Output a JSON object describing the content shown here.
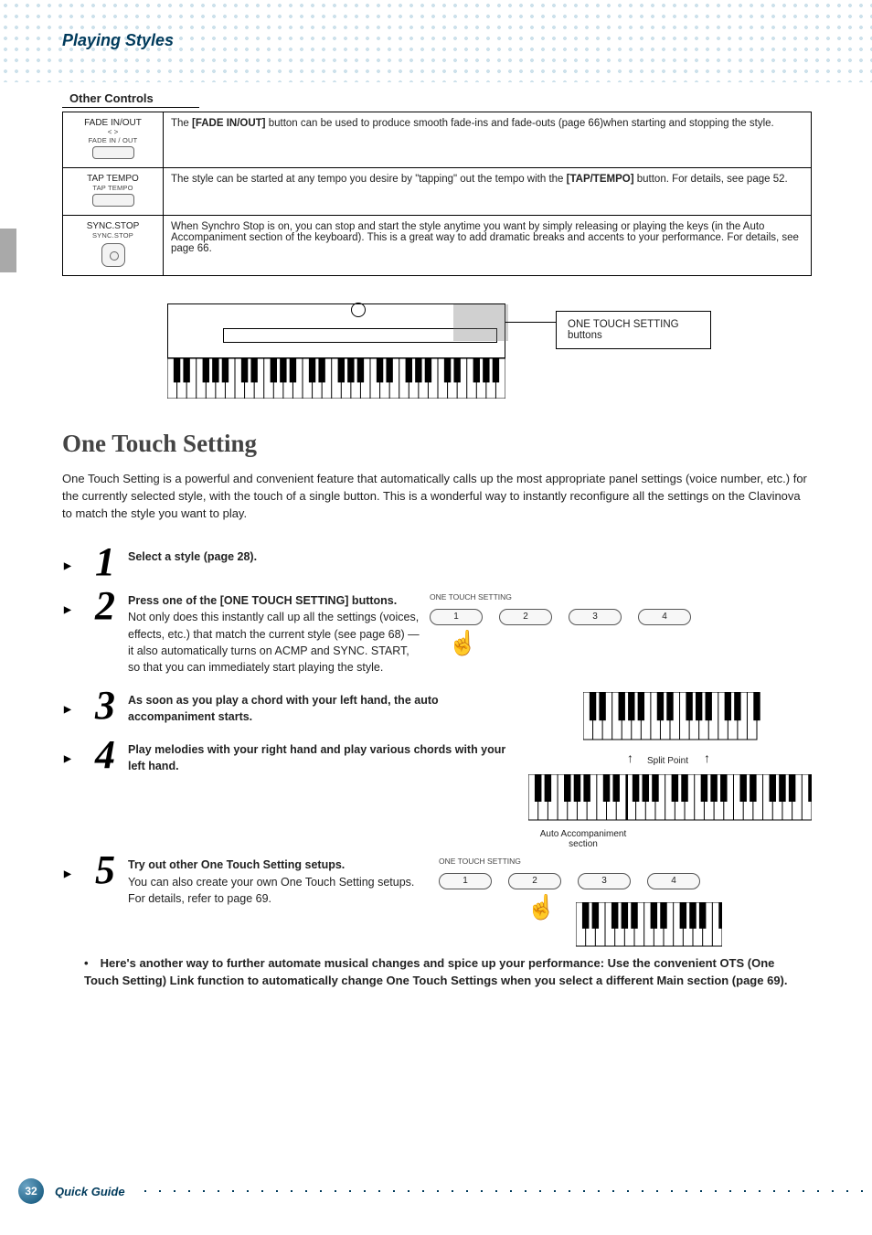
{
  "header": {
    "title": "Playing Styles"
  },
  "other_controls": {
    "heading": "Other Controls",
    "rows": [
      {
        "name": "FADE IN/OUT",
        "sub": "FADE IN / OUT",
        "desc_pre": "The ",
        "desc_bold": "[FADE IN/OUT]",
        "desc_post": " button can be used to produce smooth fade-ins and fade-outs (page 66)when starting and stopping the style."
      },
      {
        "name": "TAP TEMPO",
        "sub": "TAP TEMPO",
        "desc_pre": "The style can be started at any tempo you desire by \"tapping\" out the tempo with the ",
        "desc_bold": "[TAP/TEMPO]",
        "desc_post": " button. For details, see page 52."
      },
      {
        "name": "SYNC.STOP",
        "sub": "SYNC.STOP",
        "desc_pre": "When Synchro Stop is on, you can stop and start the style anytime you want by simply releasing or playing the keys (in the Auto Accompaniment section of the keyboard). This is a great way to add dramatic breaks and accents to your performance. For details, see page 66.",
        "desc_bold": "",
        "desc_post": ""
      }
    ]
  },
  "figure_callout": "ONE TOUCH SETTING buttons",
  "section": {
    "title": "One Touch Setting",
    "intro": "One Touch Setting is a powerful and convenient feature that automatically calls up the most appropriate panel settings (voice number, etc.) for the currently selected style, with the touch of a single button. This is a wonderful way to instantly reconfigure all the settings on the Clavinova to match the style you want to play."
  },
  "steps": {
    "s1": {
      "num": "1",
      "title": "Select a style (page 28)."
    },
    "s2": {
      "num": "2",
      "title": "Press one of the [ONE TOUCH SETTING] buttons.",
      "body": "Not only does this instantly call up all the settings (voices, effects, etc.) that match the current style (see page 68) — it also automatically turns on ACMP and SYNC. START, so that you can immediately start playing the style."
    },
    "s3": {
      "num": "3",
      "title": "As soon as you play a chord with your left hand, the auto accompaniment starts."
    },
    "s4": {
      "num": "4",
      "title": "Play melodies with your right hand and play various chords with your left hand."
    },
    "s5": {
      "num": "5",
      "title": "Try out other One Touch Setting setups.",
      "body1": "You can also create your own One Touch Setting setups.",
      "body2": "For details, refer to page 69."
    }
  },
  "ots_panel": {
    "label": "ONE TOUCH SETTING",
    "buttons": [
      "1",
      "2",
      "3",
      "4"
    ]
  },
  "kbd_split": {
    "split_label": "Split Point",
    "acc_label": "Auto Accompaniment section"
  },
  "tip": "Here's another way to further automate musical changes and spice up your performance: Use the convenient OTS (One Touch Setting) Link function to automatically change One Touch Settings when you select a different Main section (page 69).",
  "footer": {
    "page": "32",
    "label": "Quick Guide"
  }
}
